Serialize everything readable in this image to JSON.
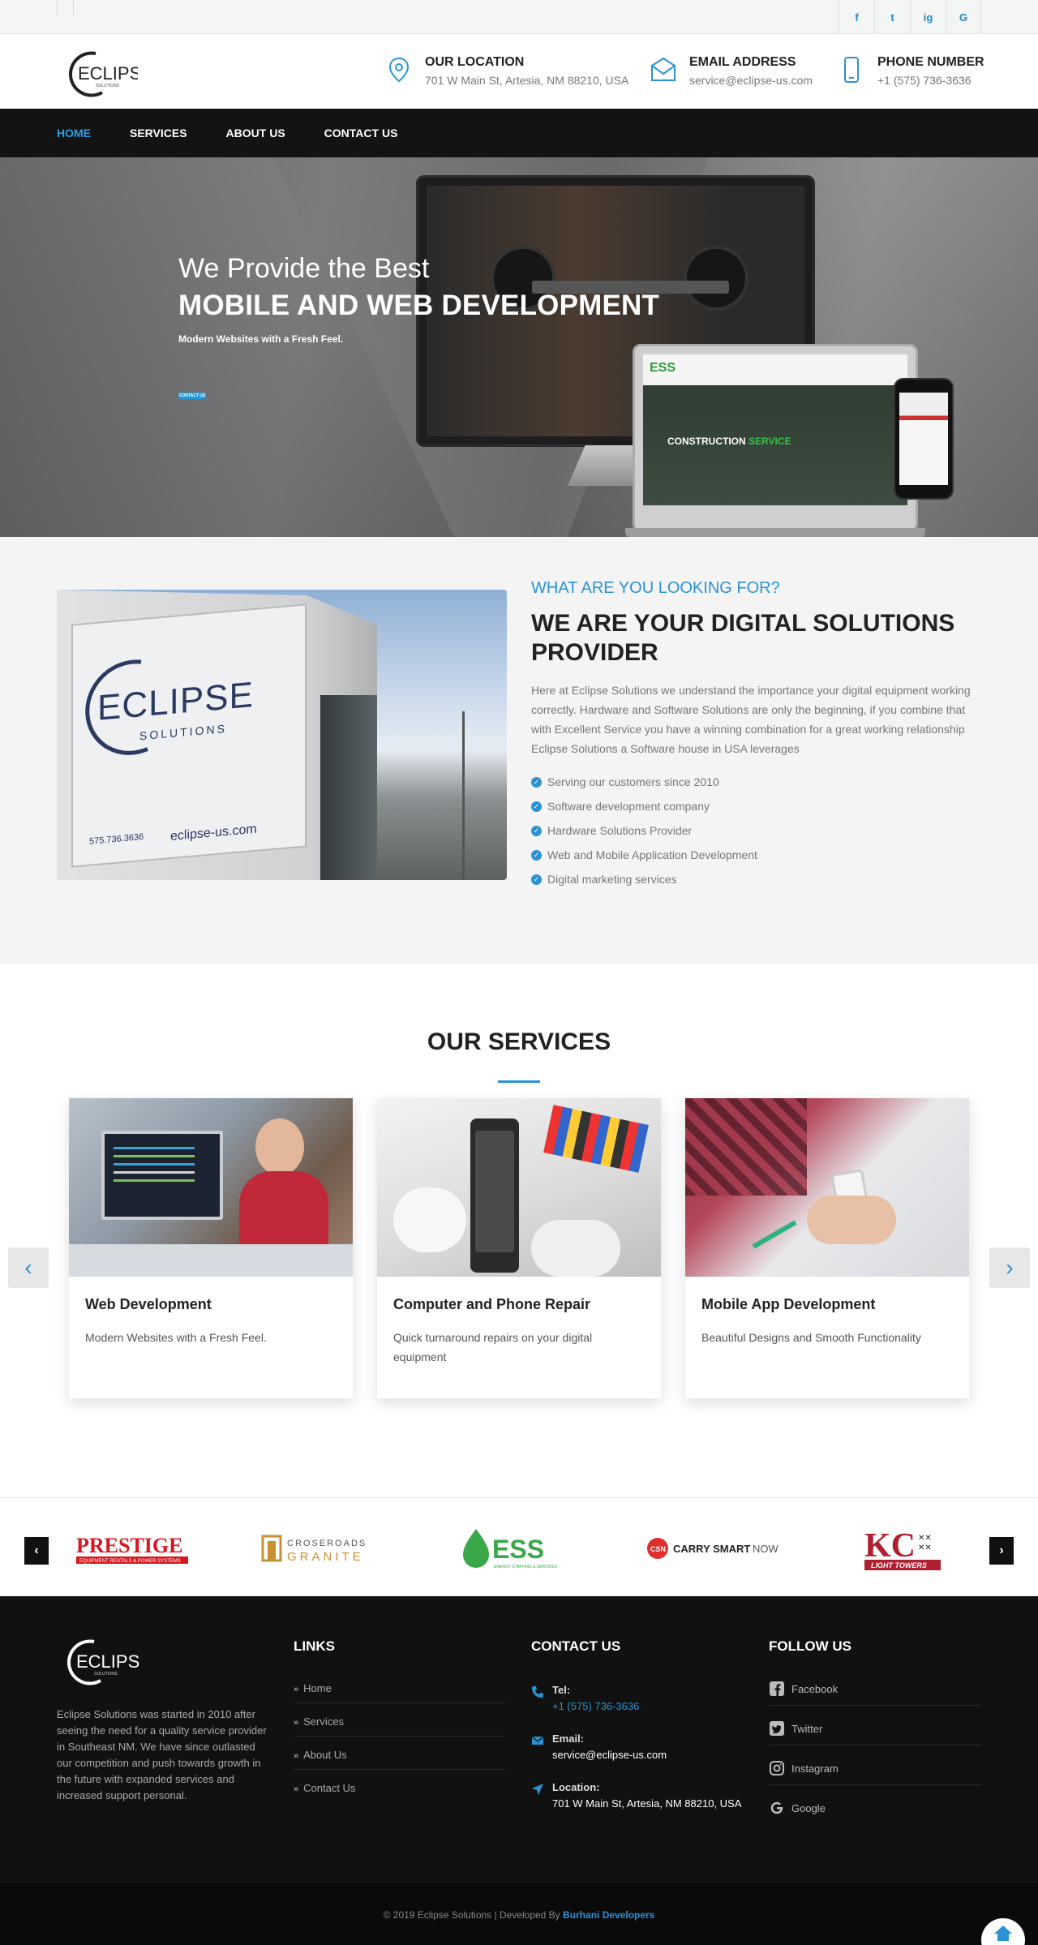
{
  "header": {
    "logo_text": "ECLIPSE",
    "logo_sub": "SOLUTIONS",
    "location": {
      "label": "OUR LOCATION",
      "value": "701 W Main St, Artesia, NM 88210, USA"
    },
    "email": {
      "label": "EMAIL ADDRESS",
      "value": "service@eclipse-us.com"
    },
    "phone": {
      "label": "PHONE NUMBER",
      "value": "+1 (575) 736-3636"
    }
  },
  "social_top": [
    "f",
    "t",
    "ig",
    "G"
  ],
  "nav": [
    {
      "label": "HOME",
      "active": true
    },
    {
      "label": "SERVICES",
      "active": false
    },
    {
      "label": "ABOUT US",
      "active": false
    },
    {
      "label": "CONTACT US",
      "active": false
    }
  ],
  "hero": {
    "line1": "We Provide the Best",
    "line2": "MOBILE AND WEB DEVELOPMENT",
    "line3": "Modern Websites with a Fresh Feel.",
    "button": "CONTACT US",
    "laptop_brand": "ESS",
    "laptop_caption_1": "CONSTRUCTION",
    "laptop_caption_2": "SERVICE"
  },
  "about": {
    "kicker": "WHAT ARE YOU LOOKING FOR?",
    "title": "WE ARE YOUR DIGITAL SOLUTIONS PROVIDER",
    "paragraph": "Here at Eclipse Solutions we understand the importance your digital equipment working correctly. Hardware and Software Solutions are only the beginning, if you combine that with Excellent Service you have a winning combination for a great working relationship Eclipse Solutions a Software house in USA leverages",
    "bullets": [
      "Serving our customers since 2010",
      "Software development company",
      "Hardware Solutions Provider",
      "Web and Mobile Application Development",
      "Digital marketing services"
    ],
    "image_sign": "ECLIPSE",
    "image_sign_sub": "SOLUTIONS",
    "image_web": "eclipse-us.com",
    "image_phone": "575.736.3636"
  },
  "services": {
    "title": "OUR SERVICES",
    "cards": [
      {
        "title": "Web Development",
        "desc": "Modern Websites with a Fresh Feel."
      },
      {
        "title": "Computer and Phone Repair",
        "desc": "Quick turnaround repairs on your digital equipment"
      },
      {
        "title": "Mobile App Development",
        "desc": "Beautiful Designs and Smooth Functionality"
      }
    ]
  },
  "clients": {
    "prestige": "PRESTIGE",
    "prestige_sub": "EQUIPMENT RENTALS & POWER SYSTEMS",
    "granite_1": "CROSEROADS",
    "granite_2": "GRANITE",
    "ess": "ESS",
    "ess_sub": "ENERGY STAFFING & SERVICES",
    "csn_badge": "CSN",
    "csn_text": "CARRY SMART",
    "csn_now": "NOW",
    "kc": "KC",
    "kc_sub": "LIGHT TOWERS"
  },
  "footer": {
    "description": "Eclipse Solutions was started in 2010 after seeing the need for a quality service provider in Southeast NM. We have since outlasted our competition and push towards growth in the future with expanded services and increased support personal.",
    "links_title": "LINKS",
    "links": [
      "Home",
      "Services",
      "About Us",
      "Contact Us"
    ],
    "contact_title": "CONTACT US",
    "contact": [
      {
        "label": "Tel:",
        "value": "+1 (575) 736-3636"
      },
      {
        "label": "Email:",
        "value": "service@eclipse-us.com"
      },
      {
        "label": "Location:",
        "value": "701 W Main St, Artesia, NM 88210, USA"
      }
    ],
    "follow_title": "FOLLOW US",
    "follow": [
      "Facebook",
      "Twitter",
      "Instagram",
      "Google"
    ]
  },
  "copyright": {
    "text": "© 2019 Eclipse Solutions | Developed By",
    "developer": "Burhani Developers"
  },
  "colors": {
    "accent": "#2a93d5",
    "nav_bg": "#131313",
    "footer_bg": "#111111"
  }
}
